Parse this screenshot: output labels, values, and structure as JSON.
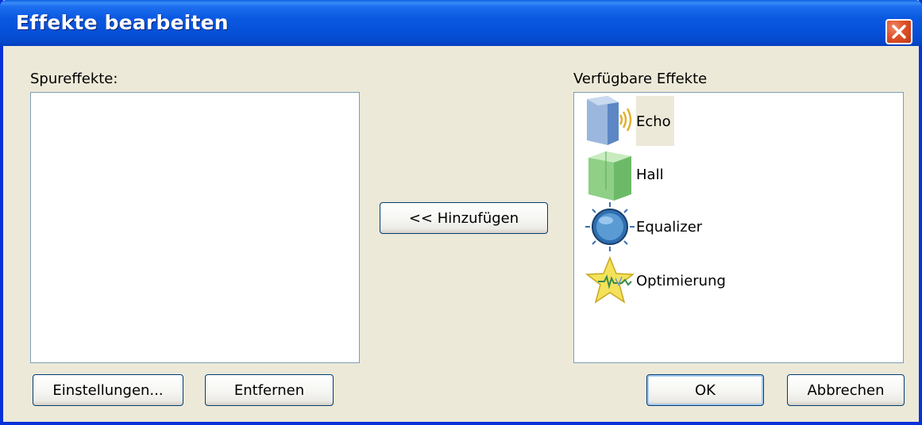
{
  "window": {
    "title": "Effekte bearbeiten",
    "close_icon": "close-icon"
  },
  "left": {
    "label": "Spureffekte:",
    "items": [],
    "settings_button": "Einstellungen...",
    "remove_button": "Entfernen"
  },
  "middle": {
    "add_button": "<< Hinzufügen"
  },
  "right": {
    "label": "Verfügbare Effekte",
    "effects": [
      {
        "label": "Echo",
        "icon": "echo-icon",
        "selected": true
      },
      {
        "label": "Hall",
        "icon": "hall-icon",
        "selected": false
      },
      {
        "label": "Equalizer",
        "icon": "equalizer-icon",
        "selected": false
      },
      {
        "label": "Optimierung",
        "icon": "optimization-icon",
        "selected": false
      }
    ],
    "ok_button": "OK",
    "cancel_button": "Abbrechen"
  },
  "colors": {
    "titlebar": "#0450d8",
    "dialog_bg": "#ece9d8",
    "close_button": "#e0502a",
    "list_border": "#7f9db9"
  }
}
